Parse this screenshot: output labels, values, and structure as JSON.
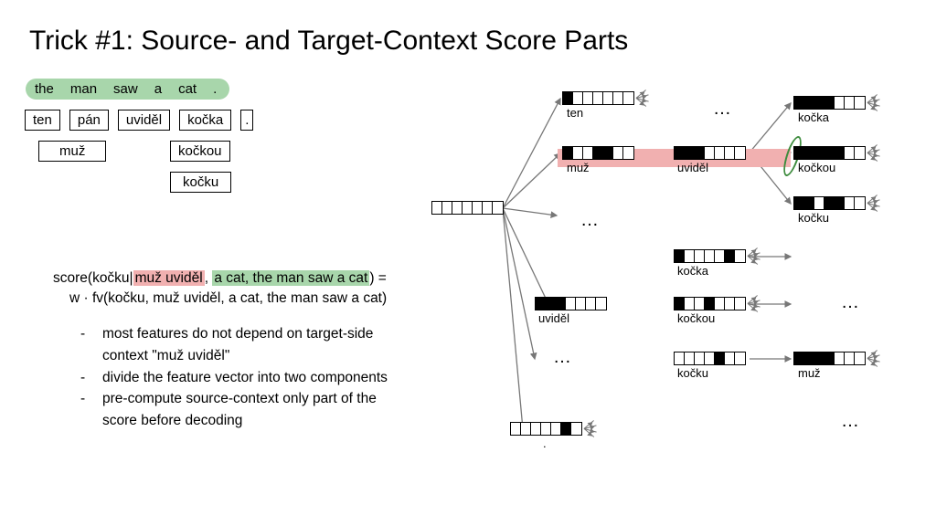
{
  "title": "Trick #1: Source- and Target-Context Score Parts",
  "source_tokens": [
    "the",
    "man",
    "saw",
    "a",
    "cat",
    "."
  ],
  "target_row1": [
    "ten",
    "pán",
    "uviděl",
    "kočka",
    "."
  ],
  "target_row2_a": "muž",
  "target_row2_b": "kočkou",
  "target_row3": "kočku",
  "score": {
    "prefix": "score(kočku|",
    "ctx_tgt": "muž uviděl",
    "sep": ", ",
    "ctx_src": "a cat, the man saw a cat",
    "suffix": ") =",
    "line2": "w · fv(kočku, muž uviděl, a cat, the man saw a cat)"
  },
  "bullets": [
    "most features do not depend on target-side",
    "context \"muž uviděl\"",
    "divide the feature vector into two components",
    "pre-compute source-context only part of the",
    "score before decoding"
  ],
  "tree": {
    "root_label": "",
    "l1": {
      "ten": "ten",
      "muz": "muž",
      "uvidel_a": "uviděl",
      "kocka_a": "kočka",
      "kockou_a": "kočkou",
      "kocku_a": "kočku",
      "uvidel_b": "uviděl",
      "dot": "."
    },
    "l2": {
      "kocka_b": "kočka",
      "kockou_b": "kočkou",
      "kocku_b": "kočku",
      "muz_b": "muž"
    },
    "ell": [
      "…",
      "…",
      "…",
      "…",
      "…",
      "…"
    ]
  },
  "chart_data": {
    "type": "other",
    "note": "diagram of translation hypothesis tree with feature-vector cell fills",
    "fv_length": 7,
    "fv_patterns": {
      "root": [
        0,
        0,
        0,
        0,
        0,
        0,
        0
      ],
      "ten": [
        1,
        0,
        0,
        0,
        0,
        0,
        0
      ],
      "muz": [
        1,
        0,
        0,
        1,
        1,
        0,
        0
      ],
      "uvidel": [
        1,
        1,
        1,
        0,
        0,
        0,
        0
      ],
      "kocka": [
        1,
        0,
        0,
        0,
        0,
        1,
        0
      ],
      "kockou": [
        1,
        0,
        0,
        1,
        0,
        0,
        0
      ],
      "kocku": [
        0,
        0,
        0,
        0,
        1,
        0,
        0
      ],
      "dot": [
        0,
        0,
        0,
        0,
        0,
        1,
        0
      ],
      "kocka2": [
        1,
        1,
        1,
        1,
        0,
        0,
        0
      ],
      "kockou2": [
        1,
        1,
        1,
        1,
        1,
        0,
        0
      ],
      "kocku2": [
        1,
        1,
        0,
        1,
        1,
        0,
        0
      ],
      "muz2": [
        1,
        1,
        1,
        1,
        0,
        0,
        0
      ]
    }
  }
}
